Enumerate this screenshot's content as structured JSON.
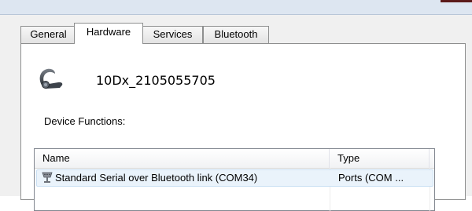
{
  "window": {
    "accent_color": "#5b1a1a"
  },
  "tabs": [
    {
      "label": "General",
      "selected": false
    },
    {
      "label": "Hardware",
      "selected": true
    },
    {
      "label": "Services",
      "selected": false
    },
    {
      "label": "Bluetooth",
      "selected": false
    }
  ],
  "device": {
    "icon": "bluetooth-headset-icon",
    "name": "10Dx_2105055705"
  },
  "functions": {
    "label": "Device Functions:",
    "columns": [
      "Name",
      "Type"
    ],
    "rows": [
      {
        "icon": "serial-port-icon",
        "name": "Standard Serial over Bluetooth link (COM34)",
        "type": "Ports (COM ..."
      }
    ]
  }
}
